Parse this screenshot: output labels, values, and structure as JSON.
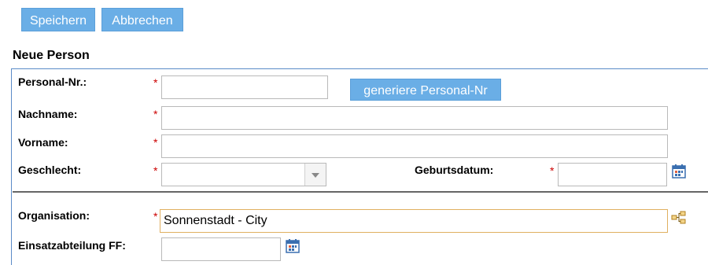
{
  "toolbar": {
    "save_label": "Speichern",
    "cancel_label": "Abbrechen"
  },
  "form": {
    "title": "Neue Person",
    "required_marker": "*",
    "personal_nr": {
      "label": "Personal-Nr.:",
      "value": ""
    },
    "generate_button_label": "generiere Personal-Nr",
    "nachname": {
      "label": "Nachname:",
      "value": ""
    },
    "vorname": {
      "label": "Vorname:",
      "value": ""
    },
    "geschlecht": {
      "label": "Geschlecht:",
      "selected": ""
    },
    "geburtsdatum": {
      "label": "Geburtsdatum:",
      "value": ""
    },
    "organisation": {
      "label": "Organisation:",
      "value": "Sonnenstadt - City"
    },
    "einsatzabteilung": {
      "label": "Einsatzabteilung FF:",
      "value": ""
    }
  },
  "icons": {
    "calendar": "calendar-icon",
    "org_tree": "org-tree-icon"
  },
  "colors": {
    "button_bg": "#6aaee6",
    "required": "#cc0000",
    "panel_border": "#5b8bc7",
    "calendar": "#3a6fb0"
  }
}
